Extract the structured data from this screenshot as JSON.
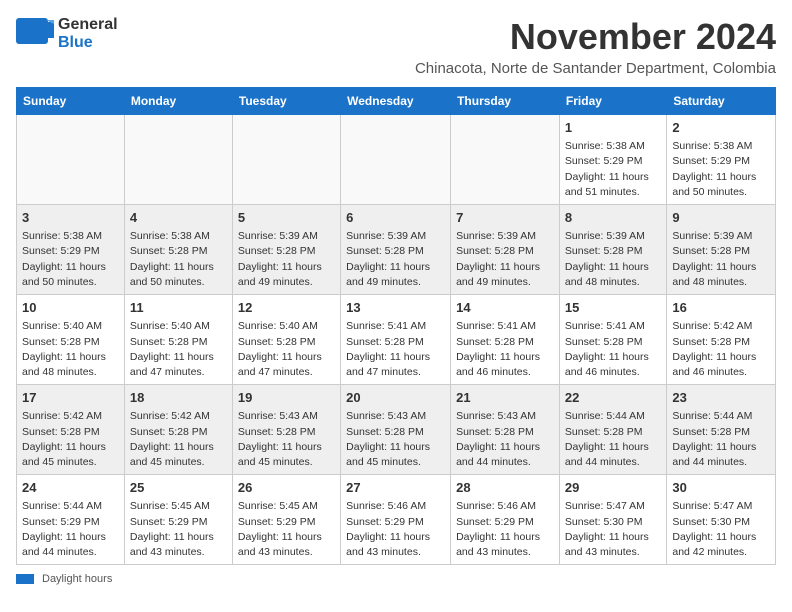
{
  "logo": {
    "line1": "General",
    "line2": "Blue"
  },
  "header": {
    "month": "November 2024",
    "location": "Chinacota, Norte de Santander Department, Colombia"
  },
  "weekdays": [
    "Sunday",
    "Monday",
    "Tuesday",
    "Wednesday",
    "Thursday",
    "Friday",
    "Saturday"
  ],
  "weeks": [
    [
      {
        "day": "",
        "info": ""
      },
      {
        "day": "",
        "info": ""
      },
      {
        "day": "",
        "info": ""
      },
      {
        "day": "",
        "info": ""
      },
      {
        "day": "",
        "info": ""
      },
      {
        "day": "1",
        "info": "Sunrise: 5:38 AM\nSunset: 5:29 PM\nDaylight: 11 hours\nand 51 minutes."
      },
      {
        "day": "2",
        "info": "Sunrise: 5:38 AM\nSunset: 5:29 PM\nDaylight: 11 hours\nand 50 minutes."
      }
    ],
    [
      {
        "day": "3",
        "info": "Sunrise: 5:38 AM\nSunset: 5:29 PM\nDaylight: 11 hours\nand 50 minutes."
      },
      {
        "day": "4",
        "info": "Sunrise: 5:38 AM\nSunset: 5:28 PM\nDaylight: 11 hours\nand 50 minutes."
      },
      {
        "day": "5",
        "info": "Sunrise: 5:39 AM\nSunset: 5:28 PM\nDaylight: 11 hours\nand 49 minutes."
      },
      {
        "day": "6",
        "info": "Sunrise: 5:39 AM\nSunset: 5:28 PM\nDaylight: 11 hours\nand 49 minutes."
      },
      {
        "day": "7",
        "info": "Sunrise: 5:39 AM\nSunset: 5:28 PM\nDaylight: 11 hours\nand 49 minutes."
      },
      {
        "day": "8",
        "info": "Sunrise: 5:39 AM\nSunset: 5:28 PM\nDaylight: 11 hours\nand 48 minutes."
      },
      {
        "day": "9",
        "info": "Sunrise: 5:39 AM\nSunset: 5:28 PM\nDaylight: 11 hours\nand 48 minutes."
      }
    ],
    [
      {
        "day": "10",
        "info": "Sunrise: 5:40 AM\nSunset: 5:28 PM\nDaylight: 11 hours\nand 48 minutes."
      },
      {
        "day": "11",
        "info": "Sunrise: 5:40 AM\nSunset: 5:28 PM\nDaylight: 11 hours\nand 47 minutes."
      },
      {
        "day": "12",
        "info": "Sunrise: 5:40 AM\nSunset: 5:28 PM\nDaylight: 11 hours\nand 47 minutes."
      },
      {
        "day": "13",
        "info": "Sunrise: 5:41 AM\nSunset: 5:28 PM\nDaylight: 11 hours\nand 47 minutes."
      },
      {
        "day": "14",
        "info": "Sunrise: 5:41 AM\nSunset: 5:28 PM\nDaylight: 11 hours\nand 46 minutes."
      },
      {
        "day": "15",
        "info": "Sunrise: 5:41 AM\nSunset: 5:28 PM\nDaylight: 11 hours\nand 46 minutes."
      },
      {
        "day": "16",
        "info": "Sunrise: 5:42 AM\nSunset: 5:28 PM\nDaylight: 11 hours\nand 46 minutes."
      }
    ],
    [
      {
        "day": "17",
        "info": "Sunrise: 5:42 AM\nSunset: 5:28 PM\nDaylight: 11 hours\nand 45 minutes."
      },
      {
        "day": "18",
        "info": "Sunrise: 5:42 AM\nSunset: 5:28 PM\nDaylight: 11 hours\nand 45 minutes."
      },
      {
        "day": "19",
        "info": "Sunrise: 5:43 AM\nSunset: 5:28 PM\nDaylight: 11 hours\nand 45 minutes."
      },
      {
        "day": "20",
        "info": "Sunrise: 5:43 AM\nSunset: 5:28 PM\nDaylight: 11 hours\nand 45 minutes."
      },
      {
        "day": "21",
        "info": "Sunrise: 5:43 AM\nSunset: 5:28 PM\nDaylight: 11 hours\nand 44 minutes."
      },
      {
        "day": "22",
        "info": "Sunrise: 5:44 AM\nSunset: 5:28 PM\nDaylight: 11 hours\nand 44 minutes."
      },
      {
        "day": "23",
        "info": "Sunrise: 5:44 AM\nSunset: 5:28 PM\nDaylight: 11 hours\nand 44 minutes."
      }
    ],
    [
      {
        "day": "24",
        "info": "Sunrise: 5:44 AM\nSunset: 5:29 PM\nDaylight: 11 hours\nand 44 minutes."
      },
      {
        "day": "25",
        "info": "Sunrise: 5:45 AM\nSunset: 5:29 PM\nDaylight: 11 hours\nand 43 minutes."
      },
      {
        "day": "26",
        "info": "Sunrise: 5:45 AM\nSunset: 5:29 PM\nDaylight: 11 hours\nand 43 minutes."
      },
      {
        "day": "27",
        "info": "Sunrise: 5:46 AM\nSunset: 5:29 PM\nDaylight: 11 hours\nand 43 minutes."
      },
      {
        "day": "28",
        "info": "Sunrise: 5:46 AM\nSunset: 5:29 PM\nDaylight: 11 hours\nand 43 minutes."
      },
      {
        "day": "29",
        "info": "Sunrise: 5:47 AM\nSunset: 5:30 PM\nDaylight: 11 hours\nand 43 minutes."
      },
      {
        "day": "30",
        "info": "Sunrise: 5:47 AM\nSunset: 5:30 PM\nDaylight: 11 hours\nand 42 minutes."
      }
    ]
  ],
  "legend": {
    "daylight_label": "Daylight hours"
  }
}
